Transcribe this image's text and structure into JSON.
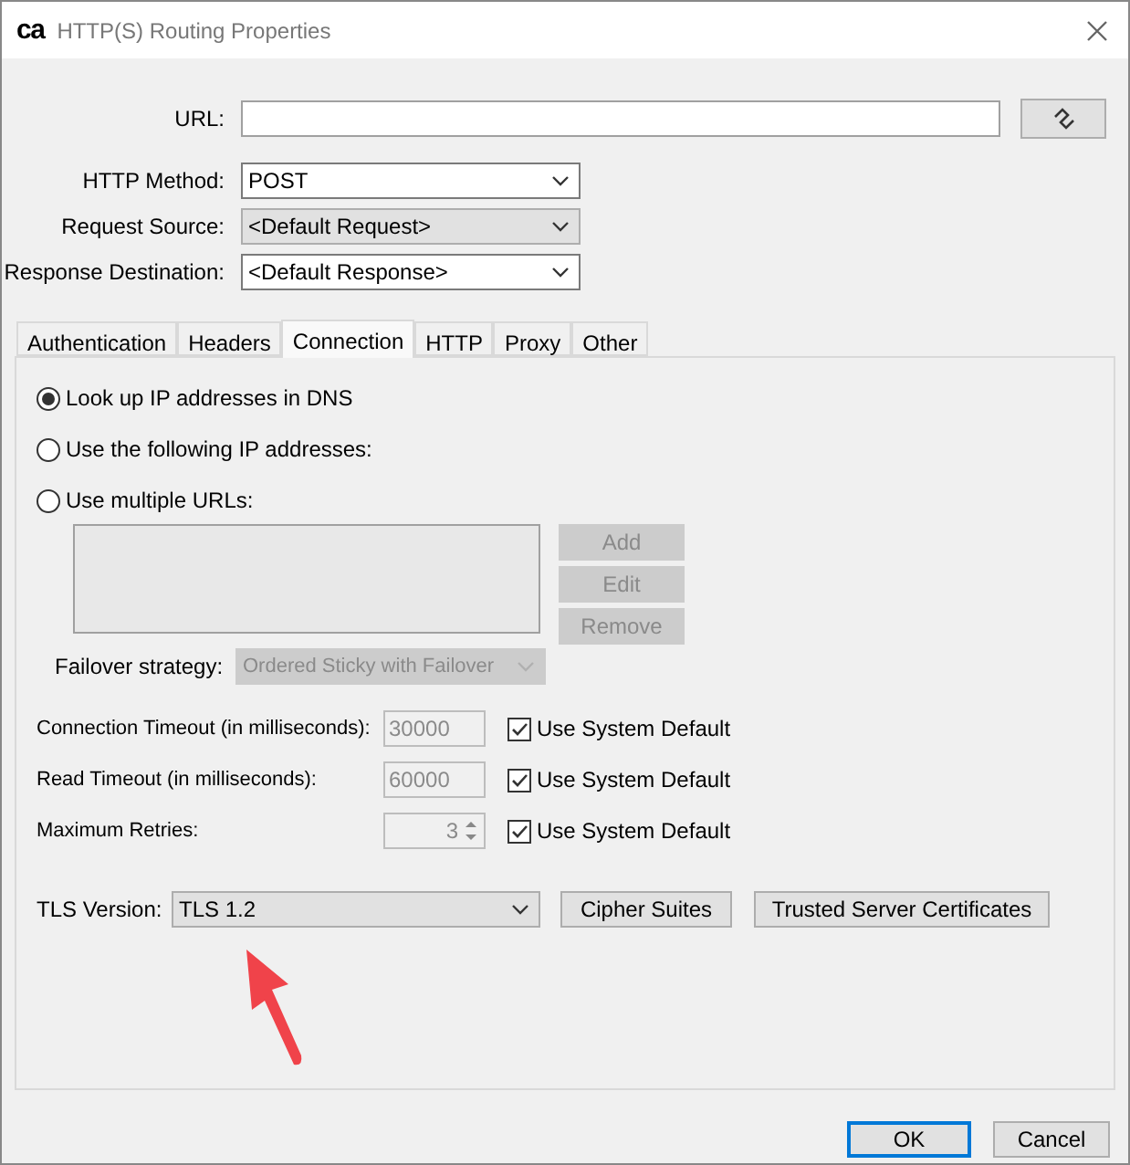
{
  "window": {
    "title": "HTTP(S) Routing Properties",
    "logo": "ca"
  },
  "fields": [
    {
      "label": "URL:",
      "kind": "text"
    },
    {
      "label": "HTTP Method:",
      "kind": "combo",
      "value": "POST"
    },
    {
      "label": "Request Source:",
      "kind": "select",
      "value": "<Default Request>"
    },
    {
      "label": "Response Destination:",
      "kind": "combo",
      "value": "<Default Response>"
    }
  ],
  "tabs": [
    {
      "label": "Authentication",
      "selected": false
    },
    {
      "label": "Headers",
      "selected": false
    },
    {
      "label": "Connection",
      "selected": true
    },
    {
      "label": "HTTP",
      "selected": false
    },
    {
      "label": "Proxy",
      "selected": false
    },
    {
      "label": "Other",
      "selected": false
    }
  ],
  "address_options": [
    {
      "label": "Look up IP addresses in DNS",
      "selected": true
    },
    {
      "label": "Use the following IP addresses:",
      "selected": false
    },
    {
      "label": "Use multiple URLs:",
      "selected": false
    }
  ],
  "url_list_buttons": [
    {
      "label": "Add",
      "disabled": true
    },
    {
      "label": "Edit",
      "disabled": true
    },
    {
      "label": "Remove",
      "disabled": true
    }
  ],
  "failover": {
    "label": "Failover strategy:",
    "value": "Ordered Sticky with Failover",
    "disabled": true
  },
  "timeouts": [
    {
      "label": "Connection Timeout (in milliseconds):",
      "kind": "text",
      "value": "30000",
      "disabled": true,
      "default_label": "Use System Default",
      "checked": true
    },
    {
      "label": "Read Timeout (in milliseconds):",
      "kind": "text",
      "value": "60000",
      "disabled": true,
      "default_label": "Use System Default",
      "checked": true
    },
    {
      "label": "Maximum Retries:",
      "kind": "spinner",
      "value": "3",
      "disabled": true,
      "default_label": "Use System Default",
      "checked": true
    }
  ],
  "tls": {
    "label": "TLS Version:",
    "value": "TLS 1.2",
    "buttons": [
      "Cipher Suites",
      "Trusted Server Certificates"
    ]
  },
  "dialog_buttons": [
    {
      "label": "OK",
      "default": true
    },
    {
      "label": "Cancel",
      "default": false
    }
  ]
}
